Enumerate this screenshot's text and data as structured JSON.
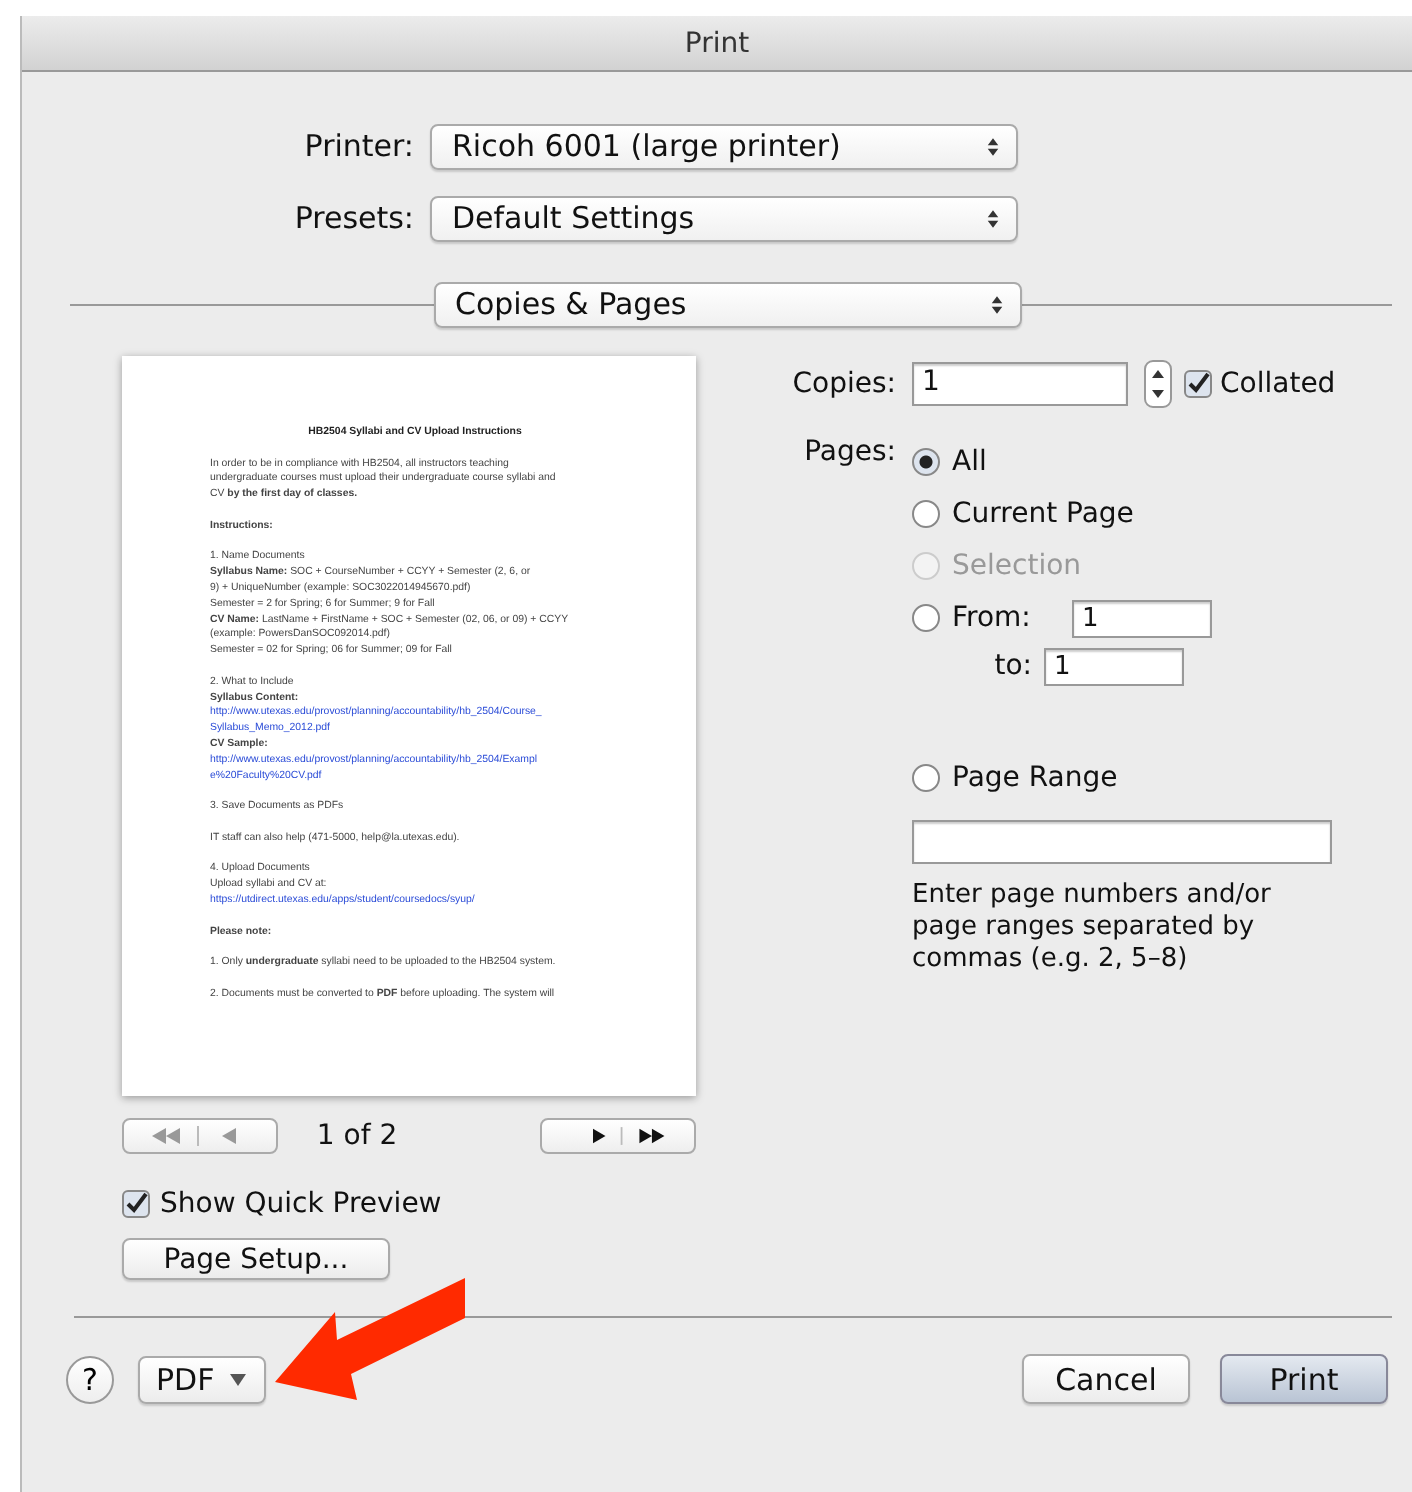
{
  "window": {
    "title": "Print"
  },
  "printer": {
    "label": "Printer:",
    "value": "Ricoh 6001 (large printer)"
  },
  "presets": {
    "label": "Presets:",
    "value": "Default Settings"
  },
  "section_menu": {
    "value": "Copies & Pages"
  },
  "preview": {
    "document": [
      {
        "lines": [
          {
            "kind": "title",
            "text": "HB2504 Syllabi and CV Upload Instructions"
          }
        ]
      },
      {
        "lines": [
          {
            "kind": "text",
            "text": "In order to be in compliance with HB2504, all instructors teaching"
          },
          {
            "kind": "text",
            "text": "undergraduate courses must upload their undergraduate course syllabi and"
          },
          {
            "kind": "text",
            "text": "CV **by the first day of classes.**"
          }
        ]
      },
      {
        "lines": [
          {
            "kind": "text",
            "text": "**Instructions:**"
          }
        ]
      },
      {
        "lines": [
          {
            "kind": "text",
            "text": "1. Name Documents"
          },
          {
            "kind": "text",
            "text": "**Syllabus Name:** SOC + CourseNumber + CCYY + Semester (2, 6, or"
          },
          {
            "kind": "text",
            "text": "9) + UniqueNumber (example: SOC3022014945670.pdf)"
          },
          {
            "kind": "text",
            "text": "Semester = 2 for Spring; 6 for Summer; 9 for Fall"
          },
          {
            "kind": "text",
            "text": "**CV Name:** LastName + FirstName + SOC + Semester (02, 06, or 09) + CCYY"
          },
          {
            "kind": "text",
            "text": "(example: PowersDanSOC092014.pdf)"
          },
          {
            "kind": "text",
            "text": "Semester = 02 for Spring; 06 for Summer; 09 for Fall"
          }
        ]
      },
      {
        "lines": [
          {
            "kind": "text",
            "text": "2. What to Include"
          },
          {
            "kind": "text",
            "text": "**Syllabus Content:**"
          },
          {
            "kind": "link",
            "text": "http://www.utexas.edu/provost/planning/accountability/hb_2504/Course_"
          },
          {
            "kind": "link",
            "text": "Syllabus_Memo_2012.pdf"
          },
          {
            "kind": "text",
            "text": "**CV Sample:**"
          },
          {
            "kind": "link",
            "text": "http://www.utexas.edu/provost/planning/accountability/hb_2504/Exampl"
          },
          {
            "kind": "link",
            "text": "e%20Faculty%20CV.pdf"
          }
        ]
      },
      {
        "lines": [
          {
            "kind": "text",
            "text": "3. Save Documents as PDFs"
          }
        ]
      },
      {
        "lines": [
          {
            "kind": "text",
            "text": "IT staff can also help (471-5000, help@la.utexas.edu)."
          }
        ]
      },
      {
        "lines": [
          {
            "kind": "text",
            "text": "4. Upload Documents"
          },
          {
            "kind": "text",
            "text": "Upload syllabi and CV at:"
          },
          {
            "kind": "link",
            "text": "https://utdirect.utexas.edu/apps/student/coursedocs/syup/"
          }
        ]
      },
      {
        "lines": [
          {
            "kind": "text",
            "text": "**Please note:**"
          }
        ]
      },
      {
        "lines": [
          {
            "kind": "text",
            "text": "1. Only **undergraduate** syllabi need to be uploaded to the HB2504 system."
          }
        ]
      },
      {
        "lines": [
          {
            "kind": "text",
            "text": "2. Documents must be converted to **PDF** before uploading. The system will"
          }
        ]
      }
    ],
    "nav_left_disabled": true,
    "nav_right_disabled": false,
    "page_indicator": "1 of 2"
  },
  "show_quick_preview": {
    "label": "Show Quick Preview",
    "checked": true
  },
  "page_setup_button": "Page Setup...",
  "copies": {
    "label": "Copies:",
    "value": "1",
    "collated": {
      "label": "Collated",
      "checked": true
    }
  },
  "pages": {
    "label": "Pages:",
    "options": [
      {
        "kind": "plain",
        "label": "All",
        "selected": true,
        "disabled": false
      },
      {
        "kind": "plain",
        "label": "Current Page",
        "selected": false,
        "disabled": false
      },
      {
        "kind": "plain",
        "label": "Selection",
        "selected": false,
        "disabled": true
      },
      {
        "kind": "range",
        "label": "From:",
        "from": "1",
        "to_label": "to:",
        "to": "1",
        "selected": false,
        "disabled": false
      },
      {
        "kind": "page_range",
        "label": "Page Range",
        "hint": "Enter page numbers and/or page ranges separated by commas (e.g. 2, 5–8)",
        "selected": false,
        "disabled": false
      }
    ]
  },
  "help_button": "?",
  "pdf_button": "PDF",
  "buttons": [
    {
      "label": "Cancel",
      "default": false
    },
    {
      "label": "Print",
      "default": true
    }
  ]
}
